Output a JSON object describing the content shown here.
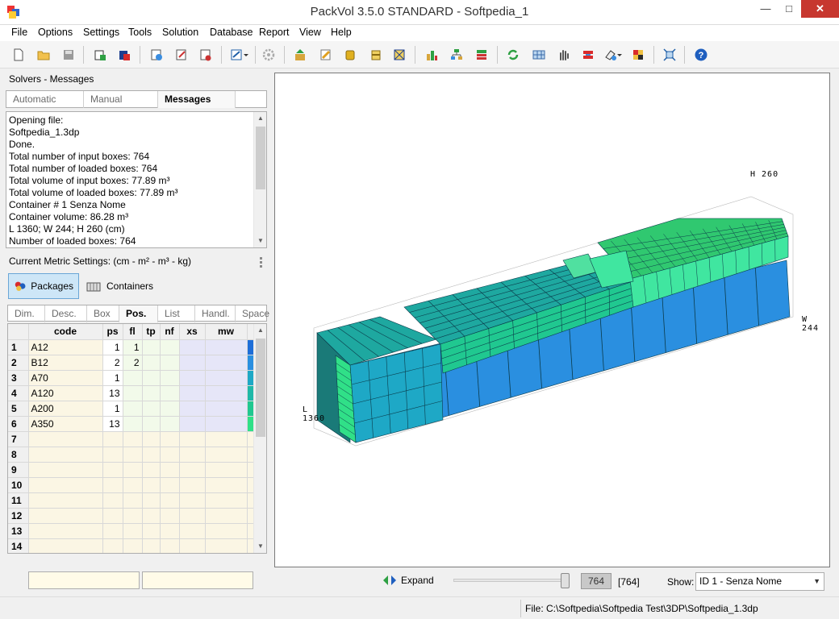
{
  "window": {
    "title": "PackVol 3.5.0 STANDARD - Softpedia_1",
    "minimize": "—",
    "maximize": "□",
    "close": "✕"
  },
  "menu": [
    "File",
    "Options",
    "Settings",
    "Tools",
    "Solution",
    "Database",
    "Report",
    "View",
    "Help"
  ],
  "toolbar_icons": [
    "new-file-icon",
    "open-folder-icon",
    "save-icon",
    "add-package-icon",
    "delete-package-icon",
    "print-preview-icon",
    "edit-icon",
    "export-icon",
    "layout-dropdown-icon",
    "settings-gear-icon",
    "load-icon",
    "pencil-icon",
    "box-stack-icon",
    "database-icon",
    "crate-icon",
    "chart-icon",
    "tree-icon",
    "layers-icon",
    "refresh-icon",
    "grid-icon",
    "hand-pan-icon",
    "split-icon",
    "paint-dropdown-icon",
    "palette-icon",
    "fit-view-icon",
    "help-icon"
  ],
  "solvers": {
    "title": "Solvers - Messages",
    "tabs": [
      "Automatic",
      "Manual",
      "Messages"
    ],
    "messages": [
      "Opening file:",
      "Softpedia_1.3dp",
      "Done.",
      "Total number of input boxes: 764",
      "Total number of loaded boxes:  764",
      "Total volume of input boxes: 77.89 m³",
      "Total volume of loaded boxes: 77.89 m³",
      "Container # 1 Senza Nome",
      "Container volume: 86.28 m³",
      "L 1360; W 244; H 260 (cm)",
      "Number of loaded boxes: 764"
    ]
  },
  "metric_settings": "Current Metric Settings: (cm - m² - m³ - kg)",
  "main_tabs": {
    "packages": "Packages",
    "containers": "Containers"
  },
  "sub_tabs": [
    "Dim.",
    "Desc.",
    "Box",
    "Pos.",
    "List",
    "Handl.",
    "Space"
  ],
  "table": {
    "columns": [
      "",
      "code",
      "ps",
      "fl",
      "tp",
      "nf",
      "xs",
      "mw"
    ],
    "rows": [
      {
        "n": "1",
        "code": "A12",
        "ps": "1",
        "fl": "1",
        "color": "#1e6ed8"
      },
      {
        "n": "2",
        "code": "B12",
        "ps": "2",
        "fl": "2",
        "color": "#2a8fe0"
      },
      {
        "n": "3",
        "code": "A70",
        "ps": "1",
        "fl": "",
        "color": "#1ea8c6"
      },
      {
        "n": "4",
        "code": "A120",
        "ps": "13",
        "fl": "",
        "color": "#1fb8a8"
      },
      {
        "n": "5",
        "code": "A200",
        "ps": "1",
        "fl": "",
        "color": "#20c890"
      },
      {
        "n": "6",
        "code": "A350",
        "ps": "13",
        "fl": "",
        "color": "#30e088"
      },
      {
        "n": "7"
      },
      {
        "n": "8"
      },
      {
        "n": "9"
      },
      {
        "n": "10"
      },
      {
        "n": "11"
      },
      {
        "n": "12"
      },
      {
        "n": "13"
      },
      {
        "n": "14"
      }
    ]
  },
  "axis_labels": {
    "h": "H 260",
    "w": "W 244",
    "l": "L 1360"
  },
  "controls": {
    "expand": "Expand",
    "count": "764",
    "count_total": "[764]",
    "show_label": "Show:",
    "show_value": "ID 1 - Senza Nome"
  },
  "status": {
    "file": "File: C:\\Softpedia\\Softpedia Test\\3DP\\Softpedia_1.3dp"
  },
  "colors": {
    "blue_box": "#2a8fe0",
    "teal_box": "#1ea8a0",
    "green_box": "#30e088",
    "dark_teal": "#1a7a78"
  }
}
